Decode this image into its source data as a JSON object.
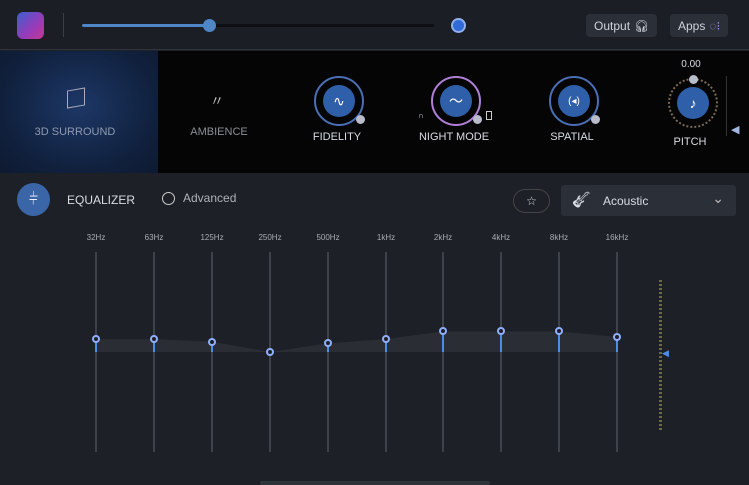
{
  "topbar": {
    "volume_percent": 36,
    "output_label": "Output",
    "apps_label": "Apps"
  },
  "effects": [
    {
      "label": "3D SURROUND",
      "active": true
    },
    {
      "label": "AMBIENCE"
    },
    {
      "label": "FIDELITY"
    },
    {
      "label": "NIGHT MODE"
    },
    {
      "label": "SPATIAL"
    },
    {
      "label": "PITCH",
      "value": "0.00"
    }
  ],
  "equalizer": {
    "title": "EQUALIZER",
    "advanced_label": "Advanced",
    "preset": "Acoustic",
    "bands": [
      {
        "freq": "32Hz",
        "gain_db": 3
      },
      {
        "freq": "63Hz",
        "gain_db": 3
      },
      {
        "freq": "125Hz",
        "gain_db": 2.4
      },
      {
        "freq": "250Hz",
        "gain_db": 0
      },
      {
        "freq": "500Hz",
        "gain_db": 2
      },
      {
        "freq": "1kHz",
        "gain_db": 3
      },
      {
        "freq": "2kHz",
        "gain_db": 4.8
      },
      {
        "freq": "4kHz",
        "gain_db": 4.8
      },
      {
        "freq": "8kHz",
        "gain_db": 4.8
      },
      {
        "freq": "16kHz",
        "gain_db": 3.5
      }
    ]
  },
  "accent": "#4c8ee6"
}
